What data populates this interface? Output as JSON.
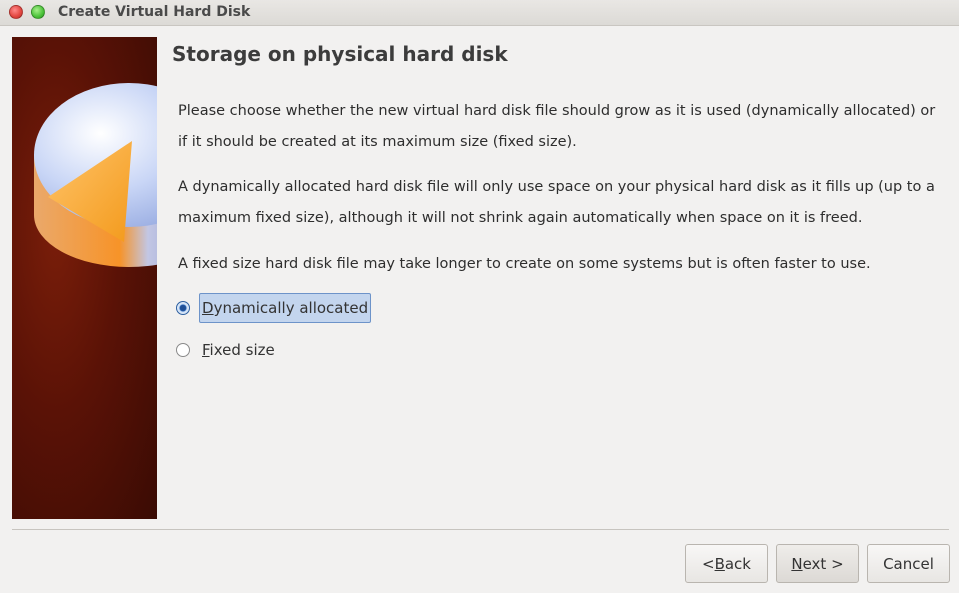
{
  "window": {
    "title": "Create Virtual Hard Disk"
  },
  "page": {
    "heading": "Storage on physical hard disk",
    "paragraph1": "Please choose whether the new virtual hard disk file should grow as it is used (dynamically allocated) or if it should be created at its maximum size (fixed size).",
    "paragraph2": "A dynamically allocated hard disk file will only use space on your physical hard disk as it fills up (up to a maximum fixed size), although it will not shrink again automatically when space on it is freed.",
    "paragraph3": "A fixed size hard disk file may take longer to create on some systems but is often faster to use."
  },
  "options": {
    "dynamic": {
      "pre": "",
      "accel": "D",
      "post": "ynamically allocated",
      "selected": true
    },
    "fixed": {
      "pre": "",
      "accel": "F",
      "post": "ixed size",
      "selected": false
    }
  },
  "buttons": {
    "back": {
      "pre": "< ",
      "accel": "B",
      "post": "ack"
    },
    "next": {
      "pre": "",
      "accel": "N",
      "post": "ext >"
    },
    "cancel": {
      "label": "Cancel"
    }
  },
  "icons": {
    "close": "close-icon",
    "maximize": "maximize-icon",
    "banner": "hard-disk-pie-icon"
  }
}
